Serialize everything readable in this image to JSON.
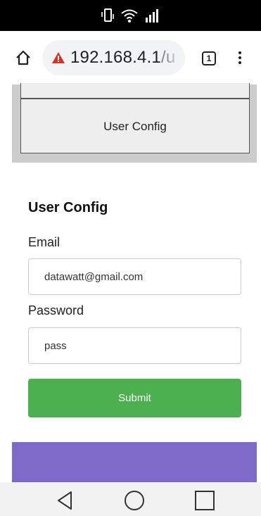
{
  "browser": {
    "url_host": "192.168.4.1",
    "url_path": "/u",
    "tab_count": "1"
  },
  "page": {
    "panel_button_label": "User Config",
    "form_title": "User Config",
    "email_label": "Email",
    "email_value": "datawatt@gmail.com",
    "password_label": "Password",
    "password_value": "pass",
    "submit_label": "Submit"
  },
  "icons": {
    "status": [
      "vibrate-icon",
      "wifi-icon",
      "signal-icon"
    ],
    "toolbar": [
      "home-icon",
      "warning-icon",
      "tab-switcher-icon",
      "more-vert-icon"
    ],
    "nav": [
      "back-icon",
      "home-circle-icon",
      "recents-icon"
    ]
  },
  "colors": {
    "submit": "#4caf50",
    "footer": "#7e6ac8",
    "warning": "#d93025",
    "panel": "#cccccc"
  }
}
